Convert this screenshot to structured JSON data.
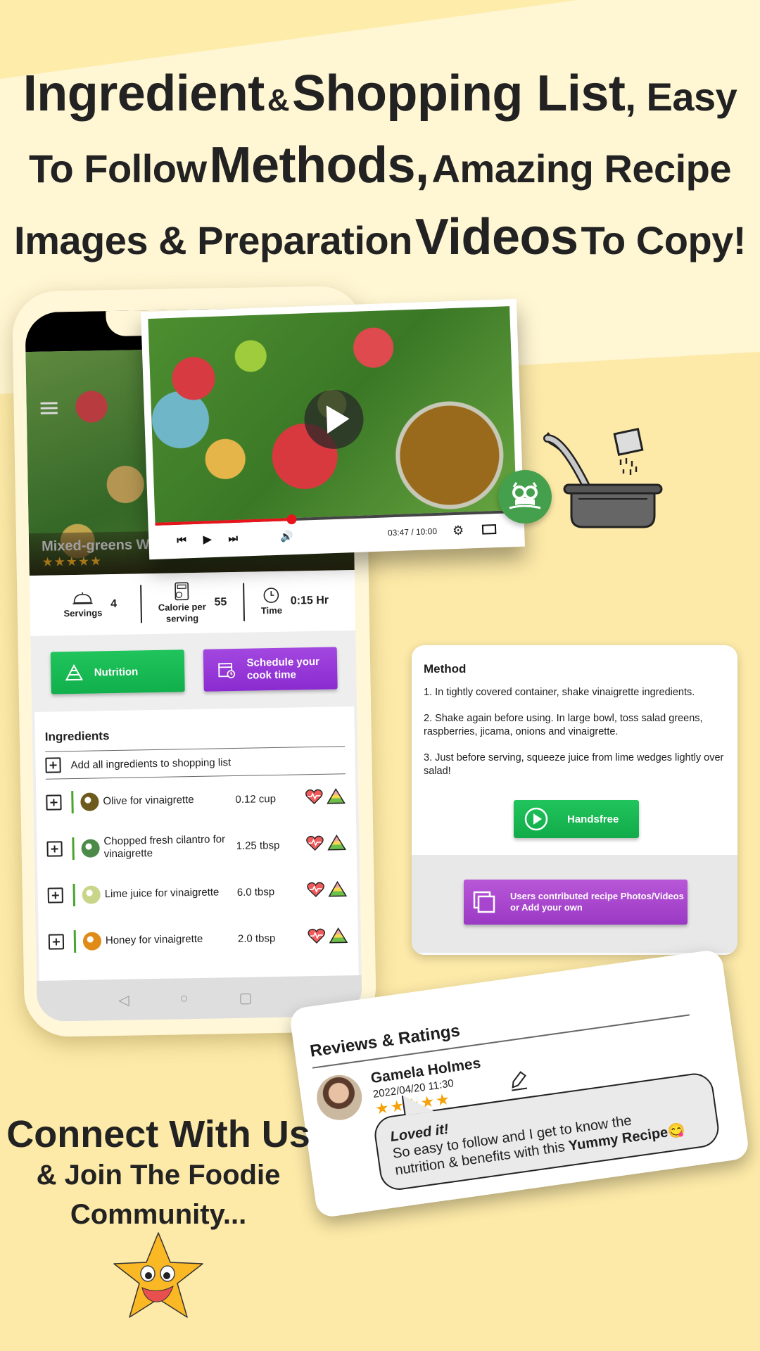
{
  "headline": {
    "line1": {
      "a": "Ingredient",
      "b": "&",
      "c": "Shopping List",
      "d": ", Easy"
    },
    "line2": {
      "a": "To Follow",
      "b": "Methods,",
      "c": "Amazing Recipe"
    },
    "line3": {
      "a": "Images & Preparation",
      "b": "Videos",
      "c": "To Copy!"
    }
  },
  "phone": {
    "recipe_title": "Mixed-greens Wi",
    "rating_stars": 5,
    "stars_text": "★★★★★",
    "stats": {
      "servings_label": "Servings",
      "servings_value": "4",
      "calorie_label_1": "Calorie per",
      "calorie_label_2": "serving",
      "calorie_value": "55",
      "time_label": "Time",
      "time_value": "0:15 Hr"
    },
    "buttons": {
      "nutrition": "Nutrition",
      "schedule_1": "Schedule your",
      "schedule_2": "cook time"
    },
    "ingredients": {
      "title": "Ingredients",
      "add_all": "Add all ingredients to shopping list",
      "items": [
        {
          "name": "Olive for vinaigrette",
          "qty": "0.12 cup",
          "thumb_color": "#6e5a1c"
        },
        {
          "name": "Chopped fresh cilantro for vinaigrette",
          "qty": "1.25 tbsp",
          "thumb_color": "#4c8a4a"
        },
        {
          "name": "Lime juice for vinaigrette",
          "qty": "6.0 tbsp",
          "thumb_color": "#c9d68a"
        },
        {
          "name": "Honey for vinaigrette",
          "qty": "2.0 tbsp",
          "thumb_color": "#e08a18"
        }
      ]
    },
    "nav": {
      "back": "◁",
      "home": "○",
      "recents": "▢"
    }
  },
  "video": {
    "current_time": "03:47",
    "duration": "10:00",
    "time_readout": "03:47 / 10:00",
    "progress": 0.378,
    "controls": {
      "prev": "⏮",
      "play": "▶",
      "next": "⏭",
      "volume": "🔊",
      "settings": "⚙"
    }
  },
  "method": {
    "title": "Method",
    "steps": [
      "1. In tightly covered container, shake vinaigrette ingredients.",
      "2. Shake again before using. In large bowl, toss salad greens, raspberries, jicama, onions and vinaigrette.",
      "3. Just before serving, squeeze juice from lime wedges lightly over salad!"
    ],
    "handsfree": "Handsfree",
    "contrib_1": "Users contributed recipe Photos/Videos",
    "contrib_2": "or Add your own"
  },
  "review": {
    "title": "Reviews & Ratings",
    "name": "Gamela Holmes",
    "date": "2022/04/20 11:30",
    "rating": 5,
    "stars_text": "★★★★★",
    "bubble_title": "Loved it!",
    "bubble_text_1": "So easy to follow and I get to know the",
    "bubble_text_2": "nutrition & benefits with this",
    "bubble_strong": "Yummy Recipe",
    "bubble_emoji": "😋"
  },
  "connect": {
    "line1": "Connect With Us",
    "line2": "& Join The Foodie",
    "line3": "Community..."
  },
  "colors": {
    "accent_green": "#17b752",
    "accent_purple": "#9a39c4",
    "video_red": "#e8141c",
    "star_orange": "#f5a20a",
    "owl_green": "#44a04c"
  }
}
